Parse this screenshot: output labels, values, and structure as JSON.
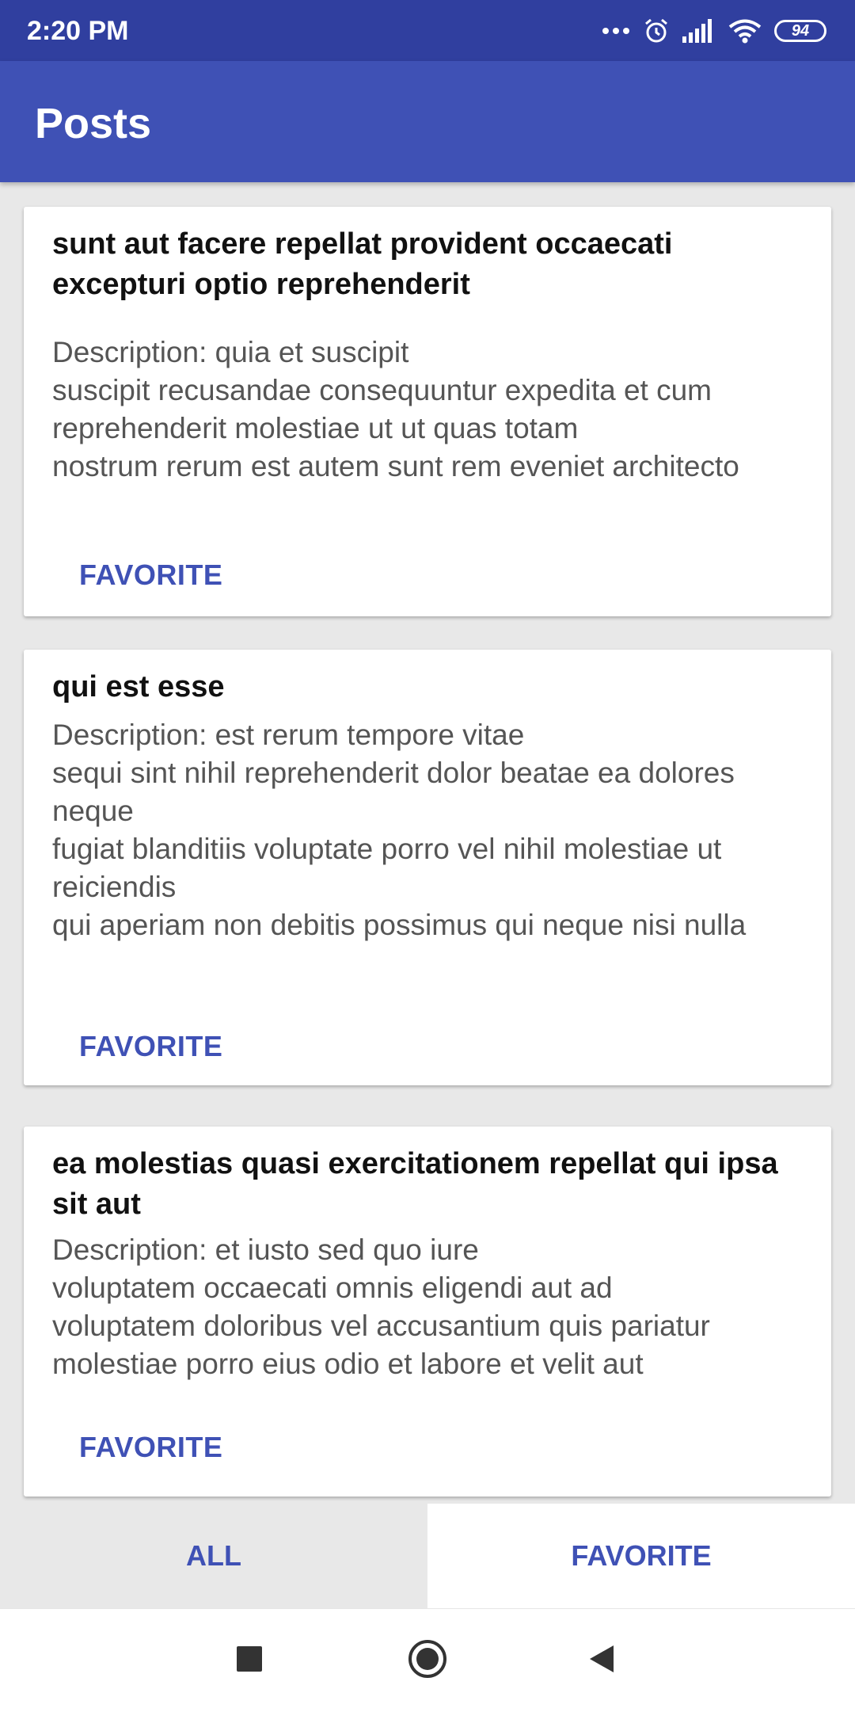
{
  "status_bar": {
    "time": "2:20 PM",
    "battery": "94",
    "icons": [
      "more-dots-icon",
      "alarm-icon",
      "signal-icon",
      "wifi-icon",
      "battery-icon"
    ]
  },
  "app_bar": {
    "title": "Posts"
  },
  "posts": [
    {
      "title": "sunt aut facere repellat provident occaecati excepturi optio reprehenderit",
      "description": "Description: quia et suscipit\nsuscipit recusandae consequuntur expedita et cum reprehenderit molestiae ut ut quas totam\nnostrum rerum est autem sunt rem eveniet architecto",
      "button": "FAVORITE"
    },
    {
      "title": "qui est esse",
      "description": "Description: est rerum tempore vitae\nsequi sint nihil reprehenderit dolor beatae ea dolores neque\nfugiat blanditiis voluptate porro vel nihil molestiae ut reiciendis\nqui aperiam non debitis possimus qui neque nisi nulla",
      "button": "FAVORITE"
    },
    {
      "title": "ea molestias quasi exercitationem repellat qui ipsa sit aut",
      "description": "Description: et iusto sed quo iure\nvoluptatem occaecati omnis eligendi aut ad\nvoluptatem doloribus vel accusantium quis pariatur\nmolestiae porro eius odio et labore et velit aut",
      "button": "FAVORITE"
    }
  ],
  "bottom_tabs": {
    "all": "ALL",
    "favorite": "FAVORITE"
  },
  "colors": {
    "primary": "#3f51b5",
    "primary_dark": "#303f9f",
    "background": "#e8e8e8"
  },
  "nav_bar": {
    "icons": [
      "recents-square-icon",
      "home-circle-icon",
      "back-triangle-icon"
    ]
  }
}
